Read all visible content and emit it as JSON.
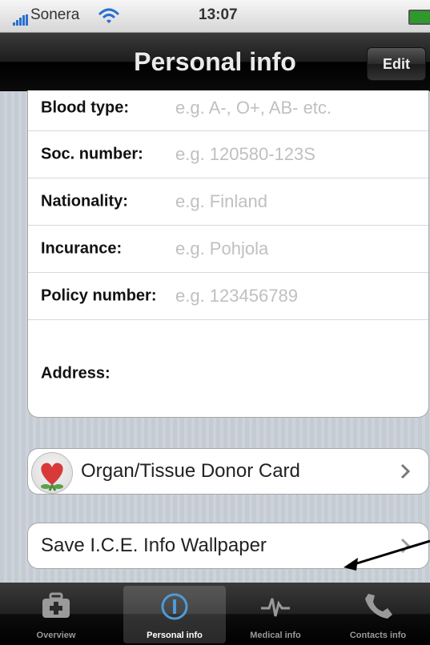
{
  "status_bar": {
    "carrier": "Sonera",
    "time": "13:07"
  },
  "nav": {
    "title": "Personal info",
    "edit_label": "Edit"
  },
  "fields": [
    {
      "label": "Blood type:",
      "placeholder": "e.g. A-, O+, AB- etc."
    },
    {
      "label": "Soc. number:",
      "placeholder": "e.g. 120580-123S"
    },
    {
      "label": "Nationality:",
      "placeholder": "e.g. Finland"
    },
    {
      "label": "Incurance:",
      "placeholder": "e.g. Pohjola"
    },
    {
      "label": "Policy number:",
      "placeholder": "e.g. 123456789"
    },
    {
      "label": "Address:",
      "placeholder": ""
    }
  ],
  "donor_card": {
    "label": "Organ/Tissue Donor Card"
  },
  "wallpaper": {
    "label": "Save I.C.E. Info Wallpaper"
  },
  "tabs": [
    {
      "label": "Overview",
      "icon": "first-aid-kit-icon"
    },
    {
      "label": "Personal info",
      "icon": "info-icon"
    },
    {
      "label": "Medical info",
      "icon": "heartbeat-icon"
    },
    {
      "label": "Contacts info",
      "icon": "phone-icon"
    }
  ],
  "colors": {
    "tab_active": "#ffffff",
    "placeholder": "#c0c0c0",
    "nav_bg": "#1d1d1d"
  }
}
